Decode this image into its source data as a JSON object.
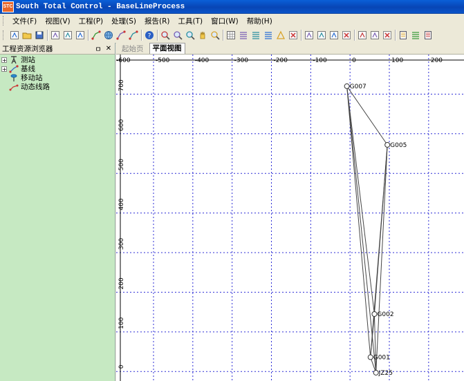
{
  "window": {
    "title": "South Total Control - BaseLineProcess",
    "app_icon_text": "STC"
  },
  "menu": [
    "文件(F)",
    "视图(V)",
    "工程(P)",
    "处理(S)",
    "报告(R)",
    "工具(T)",
    "窗口(W)",
    "帮助(H)"
  ],
  "toolbar_icons": [
    "new-file-icon",
    "open-folder-icon",
    "save-icon",
    "|",
    "import-icon",
    "print-preview-icon",
    "edit-icon",
    "|",
    "baseline-icon",
    "globe-icon",
    "coordinate-icon",
    "level-icon",
    "|",
    "help-icon",
    "|",
    "zoom-in-icon",
    "zoom-out-icon",
    "zoom-all-icon",
    "pan-hand-icon",
    "zoom-window-icon",
    "|",
    "grid-icon",
    "list-edit-icon",
    "list-icon",
    "list-detail-icon",
    "triangle-icon",
    "cross-icon",
    "|",
    "net-a-icon",
    "net-b-icon",
    "net-c-icon",
    "net-delete-icon",
    "|",
    "adjust-icon",
    "close-loop-icon",
    "error-icon",
    "|",
    "report-icon",
    "report-list-icon",
    "report-export-icon"
  ],
  "left_panel": {
    "title": "工程资源浏览器",
    "pin": "ㅁ",
    "close": "✕",
    "tree": [
      {
        "label": "测站",
        "icon": "station-icon",
        "expandable": true
      },
      {
        "label": "基线",
        "icon": "baseline-node-icon",
        "expandable": true
      },
      {
        "label": "移动站",
        "icon": "rover-icon",
        "expandable": false
      },
      {
        "label": "动态线路",
        "icon": "dynamic-route-icon",
        "expandable": false
      }
    ]
  },
  "tabs": [
    {
      "label": "起始页",
      "active": false
    },
    {
      "label": "平面视图",
      "active": true
    }
  ],
  "chart_data": {
    "type": "scatter",
    "x_ticks": [
      -600,
      -500,
      -400,
      -300,
      -200,
      -100,
      0,
      100,
      200
    ],
    "x_tick_labels": [
      "-600",
      "-500",
      "-400",
      "-300",
      "-200",
      "-100",
      "0",
      "100",
      "200"
    ],
    "y_ticks": [
      0,
      100,
      200,
      300,
      400,
      500,
      600,
      700
    ],
    "y_tick_labels": [
      "0",
      "100",
      "200",
      "300",
      "400",
      "500",
      "600",
      "700"
    ],
    "xlim": [
      -595,
      290
    ],
    "ylim": [
      -24,
      800
    ],
    "grid": true,
    "points": [
      {
        "name": "G007",
        "x": -8,
        "y": 720
      },
      {
        "name": "G005",
        "x": 95,
        "y": 572
      },
      {
        "name": "G002",
        "x": 62,
        "y": 145
      },
      {
        "name": "G001",
        "x": 52,
        "y": 36
      },
      {
        "name": "JZ25",
        "x": 66,
        "y": -3
      }
    ],
    "edges": [
      [
        "G007",
        "G005"
      ],
      [
        "G007",
        "G002"
      ],
      [
        "G007",
        "G001"
      ],
      [
        "G007",
        "JZ25"
      ],
      [
        "G005",
        "G002"
      ],
      [
        "G005",
        "G001"
      ],
      [
        "G005",
        "JZ25"
      ],
      [
        "G002",
        "G001"
      ],
      [
        "G002",
        "JZ25"
      ],
      [
        "G001",
        "JZ25"
      ]
    ]
  }
}
